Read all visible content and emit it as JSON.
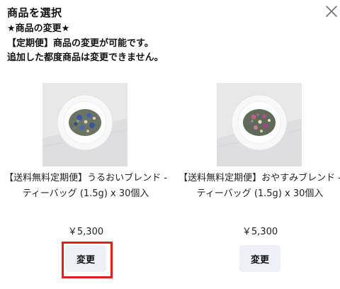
{
  "modal": {
    "title": "商品を選択",
    "notice_lines": [
      "★商品の変更★",
      "【定期便】商品の変更が可能です。",
      "追加した都度商品は変更できません。"
    ],
    "close_icon": "close-icon"
  },
  "products": [
    {
      "name": "【送料無料定期便】うるおいブレンド - ティーバッグ (1.5g) x 30個入",
      "price": "￥5,300",
      "button_label": "変更",
      "highlighted": true,
      "image": "blue-petal-tea-on-white-plate"
    },
    {
      "name": "【送料無料定期便】おやすみブレンド - ティーバッグ (1.5g) x 30個入",
      "price": "￥5,300",
      "button_label": "変更",
      "highlighted": false,
      "image": "pink-petal-tea-on-white-plate"
    }
  ],
  "colors": {
    "button_bg": "#edf1f6",
    "highlight": "#e02020",
    "thumb_bg": "#e9e9ea"
  }
}
